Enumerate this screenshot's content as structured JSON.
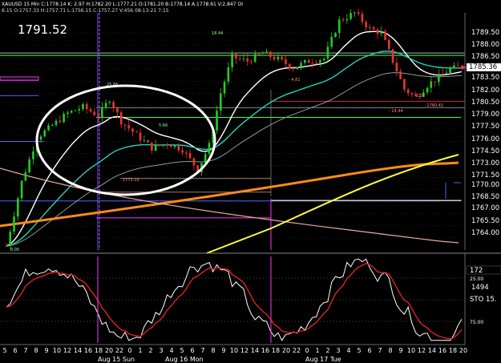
{
  "header": {
    "line1": "XAUUSD 15 Min  C:1778.14  K: 2.97  H:1782.20  L:1777.21  O:1781.20  B:1778.14  A:1778.61  V:2,847  OI",
    "line2": "6:15  O:1757.33  H:1757.71  L:1756.15  C:1757.27  V:456  08-13-21  7:15"
  },
  "big_price": "1791.52",
  "colors": {
    "background": "#000000",
    "candle_up": "#22cc22",
    "candle_down": "#ee3333",
    "cyan_ma": "#22d4c0",
    "white_ma": "#ffffff",
    "gray_ma": "#8a9a9a",
    "orange_ma": "#ff8c1a",
    "yellow_line": "#ffff44",
    "salmon_line": "#e8a8a0",
    "magenta": "#ff33ff",
    "blue": "#4466ff",
    "green_level": "#44ff44",
    "stoch_k": "#ffffff",
    "stoch_d": "#dd2222"
  },
  "price_axis": {
    "labels": [
      "1789.50",
      "1788.00",
      "1786.50",
      "1785.36",
      "1783.50",
      "1782.00",
      "1780.50",
      "1779.00",
      "1777.50",
      "1776.00",
      "1774.50",
      "1773.00",
      "1771.50",
      "1770.00",
      "1768.50",
      "1767.00",
      "1765.50",
      "1764.00"
    ],
    "current": "1785.36"
  },
  "stoch_axis": {
    "labels": [
      "172",
      "25.00",
      "1494",
      "STO  15.",
      "75.00"
    ]
  },
  "time_axis": {
    "hours": [
      "5",
      "6",
      "7",
      "8",
      "9",
      "10",
      "12",
      "14",
      "16",
      "18",
      "20",
      "22",
      "0",
      "1",
      "2",
      "3",
      "4",
      "5",
      "6",
      "7",
      "8",
      "9",
      "10",
      "12",
      "14",
      "16",
      "18",
      "20",
      "22",
      "0",
      "1",
      "2",
      "3",
      "4",
      "5",
      "6",
      "7",
      "8",
      "9",
      "10",
      "12",
      "14",
      "16",
      "18",
      "20"
    ],
    "dates": [
      "Aug 15 Sun",
      "Aug 16 Mon",
      "Aug 17 Tue"
    ]
  },
  "annotations": [
    "25.66",
    "18.44",
    "5.66",
    "- 4.81",
    "- 14.44",
    "2.52",
    "- 1780.41",
    "8.00",
    "1773.10"
  ],
  "chart_data": {
    "type": "candlestick",
    "symbol": "XAUUSD",
    "timeframe": "15 Min",
    "ylim": [
      1762.5,
      1792.0
    ],
    "close_points": [
      {
        "bar": 0,
        "price": 1763.0
      },
      {
        "bar": 4,
        "price": 1771.0
      },
      {
        "bar": 8,
        "price": 1776.5
      },
      {
        "bar": 12,
        "price": 1778.0
      },
      {
        "bar": 16,
        "price": 1779.5
      },
      {
        "bar": 20,
        "price": 1780.3
      },
      {
        "bar": 24,
        "price": 1779.2
      },
      {
        "bar": 27,
        "price": 1781.3
      },
      {
        "bar": 30,
        "price": 1778.5
      },
      {
        "bar": 34,
        "price": 1776.8
      },
      {
        "bar": 38,
        "price": 1775.2
      },
      {
        "bar": 42,
        "price": 1775.8
      },
      {
        "bar": 46,
        "price": 1775.0
      },
      {
        "bar": 50,
        "price": 1772.5
      },
      {
        "bar": 53,
        "price": 1775.5
      },
      {
        "bar": 56,
        "price": 1782.0
      },
      {
        "bar": 59,
        "price": 1786.5
      },
      {
        "bar": 63,
        "price": 1786.0
      },
      {
        "bar": 67,
        "price": 1787.0
      },
      {
        "bar": 71,
        "price": 1786.2
      },
      {
        "bar": 75,
        "price": 1785.2
      },
      {
        "bar": 79,
        "price": 1786.0
      },
      {
        "bar": 83,
        "price": 1786.3
      },
      {
        "bar": 87,
        "price": 1791.0
      },
      {
        "bar": 91,
        "price": 1792.0
      },
      {
        "bar": 95,
        "price": 1790.0
      },
      {
        "bar": 98,
        "price": 1789.5
      },
      {
        "bar": 101,
        "price": 1786.0
      },
      {
        "bar": 104,
        "price": 1782.5
      },
      {
        "bar": 107,
        "price": 1781.5
      },
      {
        "bar": 110,
        "price": 1783.0
      },
      {
        "bar": 113,
        "price": 1784.0
      },
      {
        "bar": 116,
        "price": 1785.0
      },
      {
        "bar": 119,
        "price": 1785.36
      }
    ]
  }
}
